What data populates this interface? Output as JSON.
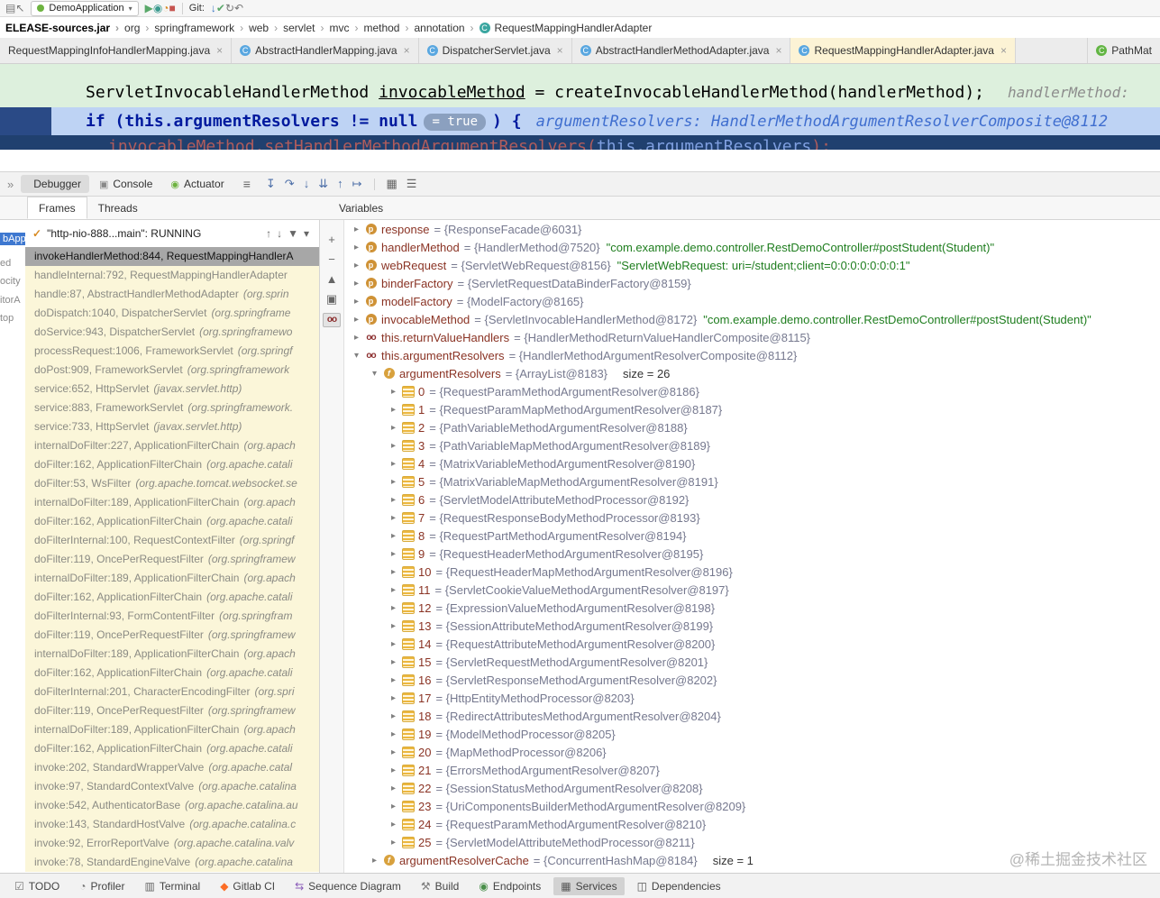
{
  "toolbar": {
    "run_config": "DemoApplication",
    "git_label": "Git:",
    "left_icons": [
      {
        "name": "window-menu-icon",
        "glyph": "▤"
      },
      {
        "name": "navigate-back-icon",
        "glyph": "↖"
      }
    ],
    "run_icons": [
      {
        "name": "run-button",
        "glyph": "▶",
        "cls": "green"
      },
      {
        "name": "coverage-button",
        "glyph": "◉",
        "cls": "teal"
      },
      {
        "name": "profiler-button",
        "glyph": "◔",
        "cls": "orange"
      },
      {
        "name": "stop-button",
        "glyph": "■",
        "cls": "red"
      }
    ],
    "git_icons": [
      {
        "name": "update-project-button",
        "glyph": "↓",
        "cls": "blue"
      },
      {
        "name": "commit-button",
        "glyph": "✔",
        "cls": "green"
      },
      {
        "name": "refresh-button",
        "glyph": "↻",
        "cls": "gray"
      },
      {
        "name": "rollback-button",
        "glyph": "↶",
        "cls": "gray"
      }
    ]
  },
  "breadcrumbs": [
    {
      "label": "ELEASE-sources.jar",
      "cls": "bold"
    },
    {
      "label": "org"
    },
    {
      "label": "springframework"
    },
    {
      "label": "web"
    },
    {
      "label": "servlet"
    },
    {
      "label": "mvc"
    },
    {
      "label": "method"
    },
    {
      "label": "annotation"
    },
    {
      "label": "RequestMappingHandlerAdapter",
      "cls": "withicon"
    }
  ],
  "editor_tabs": [
    {
      "label": "RequestMappingInfoHandlerMapping.java",
      "icon": "none"
    },
    {
      "label": "AbstractHandlerMapping.java",
      "icon": "class"
    },
    {
      "label": "DispatcherServlet.java",
      "icon": "class"
    },
    {
      "label": "AbstractHandlerMethodAdapter.java",
      "icon": "class"
    },
    {
      "label": "RequestMappingHandlerAdapter.java",
      "icon": "class",
      "cls": "active"
    },
    {
      "label": "PathMat",
      "icon": "green",
      "cls": "last cut"
    }
  ],
  "editor": {
    "line1": {
      "type": "ServletInvocableHandlerMethod ",
      "var": "invocableMethod",
      "rest": " = createInvocableHandlerMethod(handlerMethod);",
      "hint": "handlerMethod:"
    },
    "line2": {
      "kw": "if",
      "cond": " (this.argumentResolvers != null",
      "badge": "= true",
      "close": ") {",
      "hint": "argumentResolvers: HandlerMethodArgumentResolverComposite@8112"
    },
    "line3": {
      "a": "invocableMethod.setHandlerMethodArgumentResolvers(",
      "b": "this.argumentResolvers",
      "c": ");"
    }
  },
  "debugbar": {
    "collapse_glyph": "»",
    "menu_glyph": "≡",
    "tabs": [
      {
        "label": "Debugger",
        "cls": "selected"
      },
      {
        "label": "Console",
        "icon": "console"
      },
      {
        "label": "Actuator",
        "icon": "actuator"
      }
    ],
    "step_icons": [
      {
        "name": "show-execution-point-icon",
        "glyph": "↧"
      },
      {
        "name": "step-over-icon",
        "glyph": "↷"
      },
      {
        "name": "step-into-icon",
        "glyph": "↓"
      },
      {
        "name": "force-step-into-icon",
        "glyph": "⇊"
      },
      {
        "name": "step-out-icon",
        "glyph": "↑"
      },
      {
        "name": "run-to-cursor-icon",
        "glyph": "↦"
      }
    ],
    "right_icons": [
      {
        "name": "view-as-table-icon",
        "glyph": "▦"
      },
      {
        "name": "layout-settings-icon",
        "glyph": "☰"
      }
    ]
  },
  "frames_panel": {
    "tabs": [
      {
        "label": "Frames",
        "cls": "selected"
      },
      {
        "label": "Threads"
      }
    ],
    "thread_label": "\"http-nio-888...main\": RUNNING",
    "thread_icons": [
      {
        "name": "frame-up-icon",
        "glyph": "↑"
      },
      {
        "name": "frame-down-icon",
        "glyph": "↓"
      },
      {
        "name": "filter-icon",
        "glyph": "▼"
      },
      {
        "name": "chevron-down-icon",
        "glyph": "▾"
      }
    ],
    "frames": [
      {
        "main": "invokeHandlerMethod:844, RequestMappingHandlerA",
        "pkg": "",
        "cls": "sel"
      },
      {
        "main": "handleInternal:792, RequestMappingHandlerAdapter",
        "pkg": ""
      },
      {
        "main": "handle:87, AbstractHandlerMethodAdapter",
        "pkg": "(org.sprin"
      },
      {
        "main": "doDispatch:1040, DispatcherServlet",
        "pkg": "(org.springframe"
      },
      {
        "main": "doService:943, DispatcherServlet",
        "pkg": "(org.springframewo"
      },
      {
        "main": "processRequest:1006, FrameworkServlet",
        "pkg": "(org.springf"
      },
      {
        "main": "doPost:909, FrameworkServlet",
        "pkg": "(org.springframework"
      },
      {
        "main": "service:652, HttpServlet",
        "pkg": "(javax.servlet.http)"
      },
      {
        "main": "service:883, FrameworkServlet",
        "pkg": "(org.springframework."
      },
      {
        "main": "service:733, HttpServlet",
        "pkg": "(javax.servlet.http)"
      },
      {
        "main": "internalDoFilter:227, ApplicationFilterChain",
        "pkg": "(org.apach"
      },
      {
        "main": "doFilter:162, ApplicationFilterChain",
        "pkg": "(org.apache.catali"
      },
      {
        "main": "doFilter:53, WsFilter",
        "pkg": "(org.apache.tomcat.websocket.se"
      },
      {
        "main": "internalDoFilter:189, ApplicationFilterChain",
        "pkg": "(org.apach"
      },
      {
        "main": "doFilter:162, ApplicationFilterChain",
        "pkg": "(org.apache.catali"
      },
      {
        "main": "doFilterInternal:100, RequestContextFilter",
        "pkg": "(org.springf"
      },
      {
        "main": "doFilter:119, OncePerRequestFilter",
        "pkg": "(org.springframew"
      },
      {
        "main": "internalDoFilter:189, ApplicationFilterChain",
        "pkg": "(org.apach"
      },
      {
        "main": "doFilter:162, ApplicationFilterChain",
        "pkg": "(org.apache.catali"
      },
      {
        "main": "doFilterInternal:93, FormContentFilter",
        "pkg": "(org.springfram"
      },
      {
        "main": "doFilter:119, OncePerRequestFilter",
        "pkg": "(org.springframew"
      },
      {
        "main": "internalDoFilter:189, ApplicationFilterChain",
        "pkg": "(org.apach"
      },
      {
        "main": "doFilter:162, ApplicationFilterChain",
        "pkg": "(org.apache.catali"
      },
      {
        "main": "doFilterInternal:201, CharacterEncodingFilter",
        "pkg": "(org.spri"
      },
      {
        "main": "doFilter:119, OncePerRequestFilter",
        "pkg": "(org.springframew"
      },
      {
        "main": "internalDoFilter:189, ApplicationFilterChain",
        "pkg": "(org.apach"
      },
      {
        "main": "doFilter:162, ApplicationFilterChain",
        "pkg": "(org.apache.catali"
      },
      {
        "main": "invoke:202, StandardWrapperValve",
        "pkg": "(org.apache.catal"
      },
      {
        "main": "invoke:97, StandardContextValve",
        "pkg": "(org.apache.catalina"
      },
      {
        "main": "invoke:542, AuthenticatorBase",
        "pkg": "(org.apache.catalina.au"
      },
      {
        "main": "invoke:143, StandardHostValve",
        "pkg": "(org.apache.catalina.c"
      },
      {
        "main": "invoke:92, ErrorReportValve",
        "pkg": "(org.apache.catalina.valv"
      },
      {
        "main": "invoke:78, StandardEngineValve",
        "pkg": "(org.apache.catalina"
      }
    ]
  },
  "varstrip_icons": [
    {
      "name": "add-watch-icon",
      "glyph": "+"
    },
    {
      "name": "remove-watch-icon",
      "glyph": "−"
    },
    {
      "name": "move-watch-up-icon",
      "glyph": "▲"
    },
    {
      "name": "copy-value-icon",
      "glyph": "▣"
    },
    {
      "name": "show-watches-icon",
      "glyph": "oo",
      "cls": "pressed"
    }
  ],
  "variables_panel": {
    "header": "Variables",
    "rows": [
      {
        "lvl": "lvl1",
        "chev": "▸",
        "icon": "param",
        "name": "response",
        "value": "= {ResponseFacade@6031}"
      },
      {
        "lvl": "lvl1",
        "chev": "▸",
        "icon": "param",
        "name": "handlerMethod",
        "value": "= {HandlerMethod@7520}",
        "str": "\"com.example.demo.controller.RestDemoController#postStudent(Student)\""
      },
      {
        "lvl": "lvl1",
        "chev": "▸",
        "icon": "param",
        "name": "webRequest",
        "value": "= {ServletWebRequest@8156}",
        "str": "\"ServletWebRequest: uri=/student;client=0:0:0:0:0:0:0:1\""
      },
      {
        "lvl": "lvl1",
        "chev": "▸",
        "icon": "param",
        "name": "binderFactory",
        "value": "= {ServletRequestDataBinderFactory@8159}"
      },
      {
        "lvl": "lvl1",
        "chev": "▸",
        "icon": "param",
        "name": "modelFactory",
        "value": "= {ModelFactory@8165}"
      },
      {
        "lvl": "lvl1",
        "chev": "▸",
        "icon": "param",
        "name": "invocableMethod",
        "value": "= {ServletInvocableHandlerMethod@8172}",
        "str": "\"com.example.demo.controller.RestDemoController#postStudent(Student)\""
      },
      {
        "lvl": "lvl1",
        "chev": "▸",
        "icon": "watch",
        "name": "this.returnValueHandlers",
        "value": "= {HandlerMethodReturnValueHandlerComposite@8115}"
      },
      {
        "lvl": "lvl1",
        "chev": "▾",
        "icon": "watch",
        "name": "this.argumentResolvers",
        "value": "= {HandlerMethodArgumentResolverComposite@8112}"
      },
      {
        "lvl": "lvl2",
        "chev": "▾",
        "icon": "field",
        "name": "argumentResolvers",
        "value": "= {ArrayList@8183}",
        "extra": "size = 26"
      },
      {
        "lvl": "lvl3",
        "chev": "▸",
        "icon": "item",
        "name": "0",
        "value": "= {RequestParamMethodArgumentResolver@8186}"
      },
      {
        "lvl": "lvl3",
        "chev": "▸",
        "icon": "item",
        "name": "1",
        "value": "= {RequestParamMapMethodArgumentResolver@8187}"
      },
      {
        "lvl": "lvl3",
        "chev": "▸",
        "icon": "item",
        "name": "2",
        "value": "= {PathVariableMethodArgumentResolver@8188}"
      },
      {
        "lvl": "lvl3",
        "chev": "▸",
        "icon": "item",
        "name": "3",
        "value": "= {PathVariableMapMethodArgumentResolver@8189}"
      },
      {
        "lvl": "lvl3",
        "chev": "▸",
        "icon": "item",
        "name": "4",
        "value": "= {MatrixVariableMethodArgumentResolver@8190}"
      },
      {
        "lvl": "lvl3",
        "chev": "▸",
        "icon": "item",
        "name": "5",
        "value": "= {MatrixVariableMapMethodArgumentResolver@8191}"
      },
      {
        "lvl": "lvl3",
        "chev": "▸",
        "icon": "item",
        "name": "6",
        "value": "= {ServletModelAttributeMethodProcessor@8192}"
      },
      {
        "lvl": "lvl3",
        "chev": "▸",
        "icon": "item",
        "name": "7",
        "value": "= {RequestResponseBodyMethodProcessor@8193}"
      },
      {
        "lvl": "lvl3",
        "chev": "▸",
        "icon": "item",
        "name": "8",
        "value": "= {RequestPartMethodArgumentResolver@8194}"
      },
      {
        "lvl": "lvl3",
        "chev": "▸",
        "icon": "item",
        "name": "9",
        "value": "= {RequestHeaderMethodArgumentResolver@8195}"
      },
      {
        "lvl": "lvl3",
        "chev": "▸",
        "icon": "item",
        "name": "10",
        "value": "= {RequestHeaderMapMethodArgumentResolver@8196}"
      },
      {
        "lvl": "lvl3",
        "chev": "▸",
        "icon": "item",
        "name": "11",
        "value": "= {ServletCookieValueMethodArgumentResolver@8197}"
      },
      {
        "lvl": "lvl3",
        "chev": "▸",
        "icon": "item",
        "name": "12",
        "value": "= {ExpressionValueMethodArgumentResolver@8198}"
      },
      {
        "lvl": "lvl3",
        "chev": "▸",
        "icon": "item",
        "name": "13",
        "value": "= {SessionAttributeMethodArgumentResolver@8199}"
      },
      {
        "lvl": "lvl3",
        "chev": "▸",
        "icon": "item",
        "name": "14",
        "value": "= {RequestAttributeMethodArgumentResolver@8200}"
      },
      {
        "lvl": "lvl3",
        "chev": "▸",
        "icon": "item",
        "name": "15",
        "value": "= {ServletRequestMethodArgumentResolver@8201}"
      },
      {
        "lvl": "lvl3",
        "chev": "▸",
        "icon": "item",
        "name": "16",
        "value": "= {ServletResponseMethodArgumentResolver@8202}"
      },
      {
        "lvl": "lvl3",
        "chev": "▸",
        "icon": "item",
        "name": "17",
        "value": "= {HttpEntityMethodProcessor@8203}"
      },
      {
        "lvl": "lvl3",
        "chev": "▸",
        "icon": "item",
        "name": "18",
        "value": "= {RedirectAttributesMethodArgumentResolver@8204}"
      },
      {
        "lvl": "lvl3",
        "chev": "▸",
        "icon": "item",
        "name": "19",
        "value": "= {ModelMethodProcessor@8205}"
      },
      {
        "lvl": "lvl3",
        "chev": "▸",
        "icon": "item",
        "name": "20",
        "value": "= {MapMethodProcessor@8206}"
      },
      {
        "lvl": "lvl3",
        "chev": "▸",
        "icon": "item",
        "name": "21",
        "value": "= {ErrorsMethodArgumentResolver@8207}"
      },
      {
        "lvl": "lvl3",
        "chev": "▸",
        "icon": "item",
        "name": "22",
        "value": "= {SessionStatusMethodArgumentResolver@8208}"
      },
      {
        "lvl": "lvl3",
        "chev": "▸",
        "icon": "item",
        "name": "23",
        "value": "= {UriComponentsBuilderMethodArgumentResolver@8209}"
      },
      {
        "lvl": "lvl3",
        "chev": "▸",
        "icon": "item",
        "name": "24",
        "value": "= {RequestParamMethodArgumentResolver@8210}"
      },
      {
        "lvl": "lvl3",
        "chev": "▸",
        "icon": "item",
        "name": "25",
        "value": "= {ServletModelAttributeMethodProcessor@8211}"
      },
      {
        "lvl": "lvl2",
        "chev": "▸",
        "icon": "field",
        "name": "argumentResolverCache",
        "value": "= {ConcurrentHashMap@8184}",
        "extra": "size = 1"
      }
    ]
  },
  "statusbar": {
    "items": [
      {
        "label": "TODO",
        "icon": "todo",
        "name": "todo-icon"
      },
      {
        "label": "Profiler",
        "icon": "profiler",
        "name": "profiler-icon"
      },
      {
        "label": "Terminal",
        "icon": "terminal",
        "name": "terminal-icon"
      },
      {
        "label": "Gitlab CI",
        "icon": "gitlab",
        "name": "gitlab-icon"
      },
      {
        "label": "Sequence Diagram",
        "icon": "seq",
        "name": "sequence-diagram-icon"
      },
      {
        "label": "Build",
        "icon": "build",
        "name": "build-icon"
      },
      {
        "label": "Endpoints",
        "icon": "endpoints",
        "name": "endpoints-icon"
      },
      {
        "label": "Services",
        "icon": "services",
        "name": "services-icon",
        "cls": "selected"
      },
      {
        "label": "Dependencies",
        "icon": "deps",
        "name": "dependencies-icon"
      }
    ]
  },
  "watermark": "@稀土掘金技术社区",
  "left_fragments": [
    "bApp",
    "ed",
    "ocity",
    "itorA",
    "top"
  ]
}
